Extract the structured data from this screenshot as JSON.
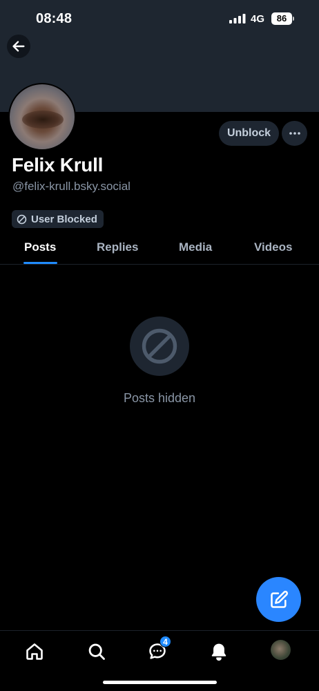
{
  "status_bar": {
    "time": "08:48",
    "network": "4G",
    "battery": "86"
  },
  "profile": {
    "display_name": "Felix Krull",
    "handle": "@felix-krull.bsky.social",
    "unblock_label": "Unblock",
    "blocked_label": "User Blocked"
  },
  "tabs": [
    {
      "label": "Posts",
      "active": true
    },
    {
      "label": "Replies",
      "active": false
    },
    {
      "label": "Media",
      "active": false
    },
    {
      "label": "Videos",
      "active": false
    }
  ],
  "feed": {
    "empty_message": "Posts hidden"
  },
  "bottom_nav": {
    "items": [
      "home-icon",
      "search-icon",
      "chat-icon",
      "bell-icon",
      "profile-avatar"
    ],
    "chat_badge": "4"
  },
  "colors": {
    "accent": "#208bfe",
    "fab": "#2a86ff",
    "banner": "#1e2630",
    "muted_text": "#8a96a6"
  }
}
